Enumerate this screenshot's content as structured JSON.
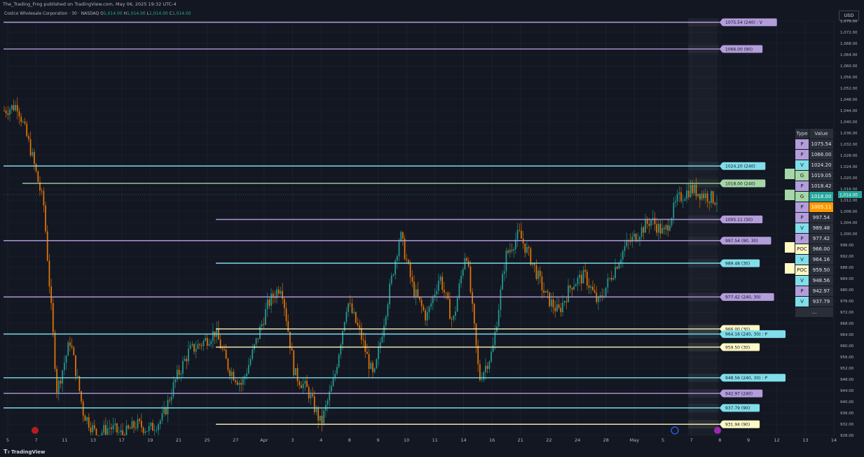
{
  "header": {
    "published": "The_Trading_Frog published on TradingView.com, May 06, 2025 19:32 UTC-4",
    "symbol": "Costco Wholesale Corporation · 30 · NASDAQ",
    "ohlc_labels": [
      "O",
      "H",
      "L",
      "C"
    ],
    "ohlc_values": [
      "1,014.00",
      "1,014.00",
      "1,014.00",
      "1,014.00"
    ]
  },
  "currency_button": "USD",
  "footer": {
    "brand": "TradingView"
  },
  "colors": {
    "background": "#131722",
    "purple": "#b39ddb",
    "cyan": "#80deea",
    "yellow": "#fff9c4",
    "green": "#a5d6a7",
    "candle_up": "#26a69a",
    "candle_down": "#f57c00",
    "current_price": "#26a69a"
  },
  "chart_data": {
    "type": "candlestick",
    "timeframe": "30",
    "ylim": [
      928,
      1076
    ],
    "y_ticks": [
      "928.00",
      "932.00",
      "936.00",
      "940.00",
      "944.00",
      "948.00",
      "952.00",
      "956.00",
      "960.00",
      "964.00",
      "968.00",
      "972.00",
      "976.00",
      "980.00",
      "984.00",
      "988.00",
      "992.00",
      "996.00",
      "1,000.00",
      "1,004.00",
      "1,008.00",
      "1,012.00",
      "1,016.00",
      "1,020.00",
      "1,024.00",
      "1,028.00",
      "1,032.00",
      "1,036.00",
      "1,040.00",
      "1,044.00",
      "1,048.00",
      "1,052.00",
      "1,056.00",
      "1,060.00",
      "1,064.00",
      "1,068.00",
      "1,072.00",
      "1,076.00"
    ],
    "x_ticks": [
      "5",
      "7",
      "11",
      "13",
      "17",
      "19",
      "21",
      "25",
      "27",
      "Apr",
      "3",
      "4",
      "8",
      "9",
      "10",
      "11",
      "14",
      "16",
      "21",
      "22",
      "24",
      "28",
      "May",
      "5",
      "7",
      "8",
      "9",
      "12",
      "13",
      "14"
    ],
    "current_price": "1,014.00",
    "price_path": [
      1044,
      1046,
      1030,
      1010,
      944,
      962,
      936,
      928,
      931,
      928,
      932,
      930,
      934,
      948,
      958,
      961,
      965,
      952,
      946,
      960,
      975,
      982,
      950,
      944,
      932,
      948,
      976,
      964,
      948,
      975,
      1000,
      980,
      970,
      985,
      968,
      995,
      948,
      958,
      992,
      1000,
      990,
      978,
      972,
      982,
      985,
      975,
      985,
      995,
      1000,
      1005,
      1000,
      1012,
      1016,
      1014,
      1012
    ],
    "levels": [
      {
        "value": 1075.54,
        "label": "1075.54 (240) : V",
        "color": "purple"
      },
      {
        "value": 1066.0,
        "label": "1066.00 (90)",
        "color": "purple"
      },
      {
        "value": 1024.2,
        "label": "1024.20 (240)",
        "color": "cyan"
      },
      {
        "value": 1018.0,
        "label": "1018.00 (240)",
        "color": "green"
      },
      {
        "value": 1005.11,
        "label": "1005.11 (30)",
        "color": "purple"
      },
      {
        "value": 997.54,
        "label": "997.54 (90, 30)",
        "color": "purple"
      },
      {
        "value": 989.48,
        "label": "989.48 (30)",
        "color": "cyan"
      },
      {
        "value": 977.42,
        "label": "977.42 (240, 30)",
        "color": "purple"
      },
      {
        "value": 966.0,
        "label": "966.00 (30)",
        "color": "yellow"
      },
      {
        "value": 964.16,
        "label": "964.16 (240, 30) : P",
        "color": "cyan"
      },
      {
        "value": 959.5,
        "label": "959.50 (30)",
        "color": "yellow"
      },
      {
        "value": 948.56,
        "label": "948.56 (240, 30) : P",
        "color": "cyan"
      },
      {
        "value": 942.97,
        "label": "942.97 (240)",
        "color": "purple"
      },
      {
        "value": 937.79,
        "label": "937.79 (90)",
        "color": "cyan"
      },
      {
        "value": 931.94,
        "label": "931.94 (90)",
        "color": "yellow"
      }
    ]
  },
  "table": {
    "headers": [
      "Type",
      "Value"
    ],
    "rows": [
      {
        "type": "P",
        "value": "1075.54",
        "color": "purple"
      },
      {
        "type": "P",
        "value": "1066.00",
        "color": "purple"
      },
      {
        "type": "V",
        "value": "1024.20",
        "color": "cyan"
      },
      {
        "type": "G",
        "value": "1019.05",
        "color": "green"
      },
      {
        "type": "P",
        "value": "1018.42",
        "color": "purple"
      },
      {
        "type": "G",
        "value": "1018.00",
        "color": "green"
      },
      {
        "type": "P",
        "value": "1005.11",
        "color": "purple"
      },
      {
        "type": "P",
        "value": "997.54",
        "color": "purple"
      },
      {
        "type": "V",
        "value": "989.48",
        "color": "cyan"
      },
      {
        "type": "P",
        "value": "977.42",
        "color": "purple"
      },
      {
        "type": "POC",
        "value": "966.00",
        "color": "yellow"
      },
      {
        "type": "V",
        "value": "964.16",
        "color": "cyan"
      },
      {
        "type": "POC",
        "value": "959.50",
        "color": "yellow"
      },
      {
        "type": "V",
        "value": "948.56",
        "color": "cyan"
      },
      {
        "type": "P",
        "value": "942.97",
        "color": "purple"
      },
      {
        "type": "V",
        "value": "937.79",
        "color": "cyan"
      }
    ],
    "more": "..."
  }
}
